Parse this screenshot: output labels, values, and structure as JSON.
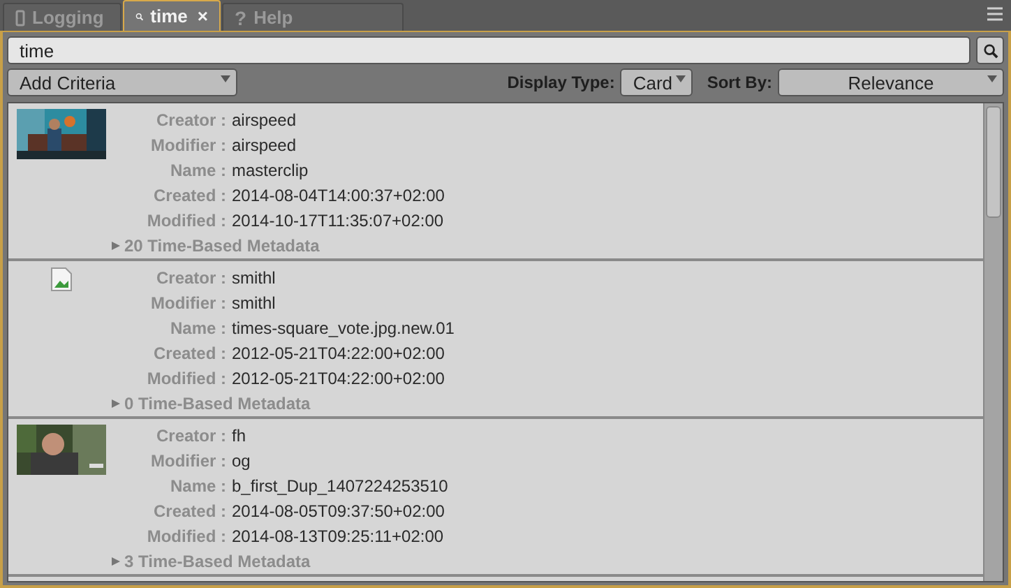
{
  "tabs": [
    {
      "kind": "device",
      "label": "Logging",
      "selected": false
    },
    {
      "kind": "search",
      "label": "time",
      "selected": true,
      "close_glyph": "×"
    },
    {
      "kind": "help",
      "glyph": "?",
      "label": "Help",
      "selected": false
    }
  ],
  "search": {
    "value": "time"
  },
  "criteria": {
    "label": "Add Criteria"
  },
  "display_type": {
    "label": "Display Type:",
    "value": "Card"
  },
  "sort_by": {
    "label": "Sort By:",
    "value": "Relevance"
  },
  "cards": [
    {
      "kind": "picture",
      "fields": [
        {
          "label": "Creator :",
          "value": "airspeed"
        },
        {
          "label": "Modifier :",
          "value": "airspeed"
        },
        {
          "label": "Name :",
          "value": "masterclip"
        },
        {
          "label": "Created :",
          "value": "2014-08-04T14:00:37+02:00"
        },
        {
          "label": "Modified :",
          "value": "2014-10-17T11:35:07+02:00"
        }
      ],
      "metadata": {
        "label": "20 Time-Based Metadata",
        "expanded": false
      }
    },
    {
      "kind": "broken-image",
      "fields": [
        {
          "label": "Creator :",
          "value": "smithl"
        },
        {
          "label": "Modifier :",
          "value": "smithl"
        },
        {
          "label": "Name :",
          "value": "times-square_vote.jpg.new.01"
        },
        {
          "label": "Created :",
          "value": "2012-05-21T04:22:00+02:00"
        },
        {
          "label": "Modified :",
          "value": "2012-05-21T04:22:00+02:00"
        }
      ],
      "metadata": {
        "label": "0 Time-Based Metadata",
        "expanded": false
      }
    },
    {
      "kind": "picture",
      "fields": [
        {
          "label": "Creator :",
          "value": "fh"
        },
        {
          "label": "Modifier :",
          "value": "og"
        },
        {
          "label": "Name :",
          "value": "b_first_Dup_1407224253510"
        },
        {
          "label": "Created :",
          "value": "2014-08-05T09:37:50+02:00"
        },
        {
          "label": "Modified :",
          "value": "2014-08-13T09:25:11+02:00"
        }
      ],
      "metadata": {
        "label": "3 Time-Based Metadata",
        "expanded": false
      }
    }
  ]
}
